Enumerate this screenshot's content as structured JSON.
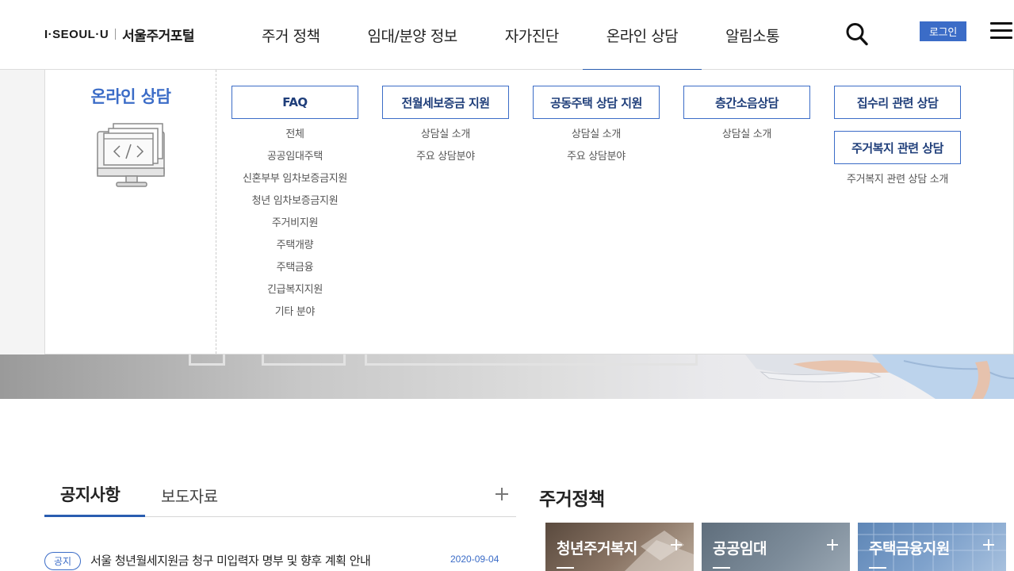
{
  "header": {
    "logo_mark": "I·SEOUL·U",
    "logo_text": "서울주거포털",
    "nav": [
      "주거 정책",
      "임대/분양 정보",
      "자가진단",
      "온라인 상담",
      "알림소통"
    ],
    "active_nav_index": 3,
    "login_label": "로그인",
    "icons": {
      "search": "search-icon",
      "menu": "hamburger-menu-icon"
    },
    "accent_color": "#3b6cc7"
  },
  "mega_menu": {
    "title": "온라인 상담",
    "illustration": "computer-code-icon",
    "columns": [
      {
        "boxes": [
          "FAQ"
        ],
        "links": [
          "전체",
          "공공임대주택",
          "신혼부부 임차보증금지원",
          "청년 임차보증금지원",
          "주거비지원",
          "주택개량",
          "주택금융",
          "긴급복지지원",
          "기타 분야"
        ]
      },
      {
        "boxes": [
          "전월세보증금 지원"
        ],
        "links": [
          "상담실 소개",
          "주요 상담분야"
        ]
      },
      {
        "boxes": [
          "공동주택 상담 지원"
        ],
        "links": [
          "상담실 소개",
          "주요 상담분야"
        ]
      },
      {
        "boxes": [
          "층간소음상담"
        ],
        "links": [
          "상담실 소개"
        ]
      },
      {
        "boxes": [
          "집수리 관련 상담",
          "주거복지 관련 상담"
        ],
        "links": [
          "주거복지 관련 상담 소개"
        ]
      }
    ]
  },
  "notice": {
    "tabs": [
      "공지사항",
      "보도자료"
    ],
    "items": [
      {
        "badge": "공지",
        "title": "서울 청년월세지원금 청구 미입력자 명부 및 향후 계획 안내",
        "date": "2020-09-04"
      }
    ]
  },
  "policy": {
    "title": "주거정책",
    "cards": [
      "청년주거복지",
      "공공임대",
      "주택금융지원"
    ]
  }
}
